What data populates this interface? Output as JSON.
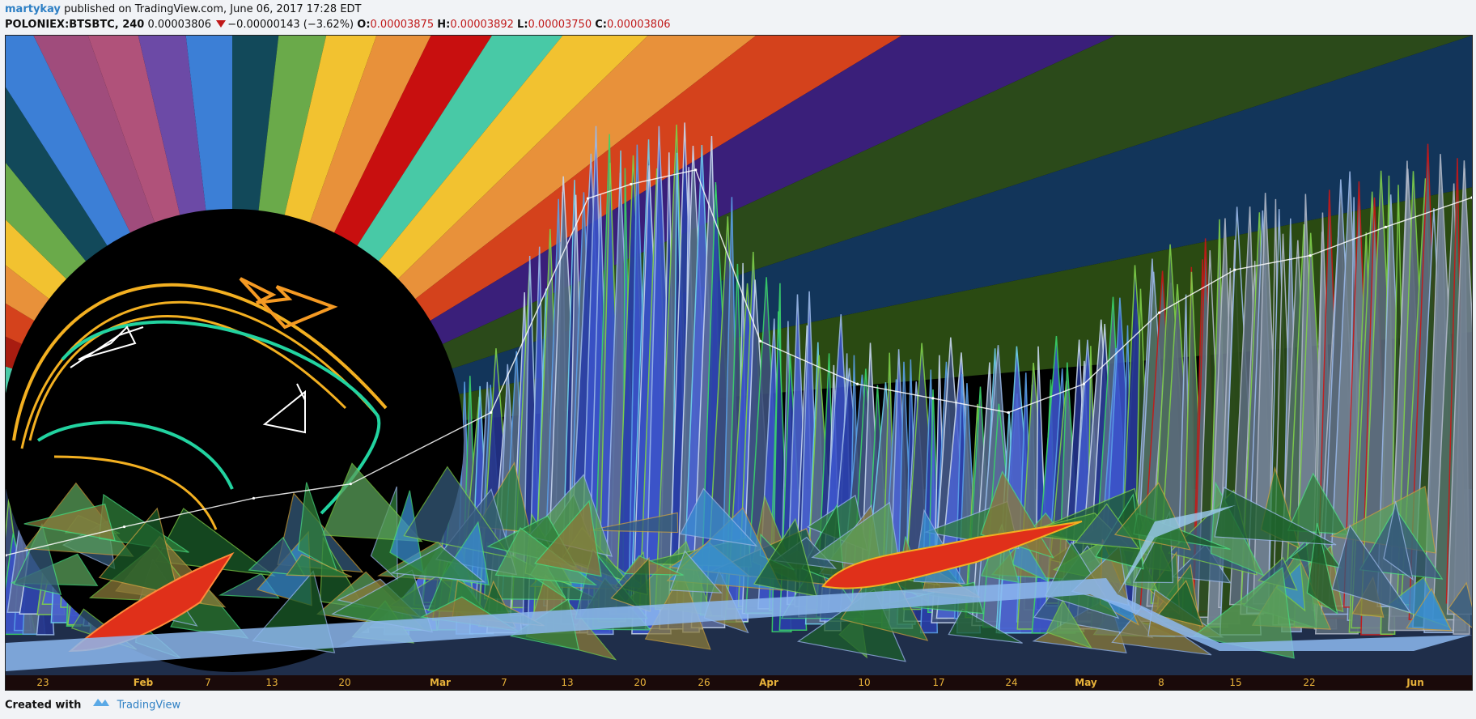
{
  "header": {
    "author": "martykay",
    "published_text": "published on TradingView.com, June 06, 2017 17:28 EDT",
    "symbol": "POLONIEX:BTSBTC, 240",
    "last": "0.00003806",
    "change": "−0.00000143 (−3.62%)",
    "open_label": "O:",
    "open": "0.00003875",
    "high_label": "H:",
    "high": "0.00003892",
    "low_label": "L:",
    "low": "0.00003750",
    "close_label": "C:",
    "close": "0.00003806"
  },
  "footer": {
    "created_with": "Created with",
    "brand": "TradingView"
  },
  "colors": {
    "tick_label": "#e8b23a",
    "axis_bg": "#1a0a0a",
    "price_down": "#c01818",
    "brand": "#2d7fc4"
  },
  "chart_data": {
    "type": "line",
    "title": "POLONIEX:BTSBTC, 240",
    "x_tick_labels": [
      "23",
      "Feb",
      "7",
      "13",
      "20",
      "Mar",
      "7",
      "13",
      "20",
      "26",
      "Apr",
      "10",
      "17",
      "24",
      "May",
      "8",
      "15",
      "22",
      "Jun"
    ],
    "x_range": [
      "2017-01-21",
      "2017-06-06"
    ],
    "y_axis_labels_visible": false,
    "grid": false,
    "legend": "none",
    "series": [
      {
        "values": [
          {
            "x": "2017-01-21",
            "y": 1.3e-05
          },
          {
            "x": "2017-02-01",
            "y": 1.5e-05
          },
          {
            "x": "2017-02-13",
            "y": 1.7e-05
          },
          {
            "x": "2017-02-22",
            "y": 1.8e-05
          },
          {
            "x": "2017-03-07",
            "y": 2.3e-05
          },
          {
            "x": "2017-03-16",
            "y": 3.8e-05
          },
          {
            "x": "2017-03-20",
            "y": 3.9e-05
          },
          {
            "x": "2017-03-26",
            "y": 4e-05
          },
          {
            "x": "2017-04-01",
            "y": 2.8e-05
          },
          {
            "x": "2017-04-10",
            "y": 2.5e-05
          },
          {
            "x": "2017-04-17",
            "y": 2.4e-05
          },
          {
            "x": "2017-04-24",
            "y": 2.3e-05
          },
          {
            "x": "2017-05-01",
            "y": 2.5e-05
          },
          {
            "x": "2017-05-08",
            "y": 3e-05
          },
          {
            "x": "2017-05-15",
            "y": 3.3e-05
          },
          {
            "x": "2017-05-22",
            "y": 3.4e-05
          },
          {
            "x": "2017-05-29",
            "y": 3.6e-05
          },
          {
            "x": "2017-06-06",
            "y": 3.806e-05
          }
        ]
      }
    ]
  }
}
